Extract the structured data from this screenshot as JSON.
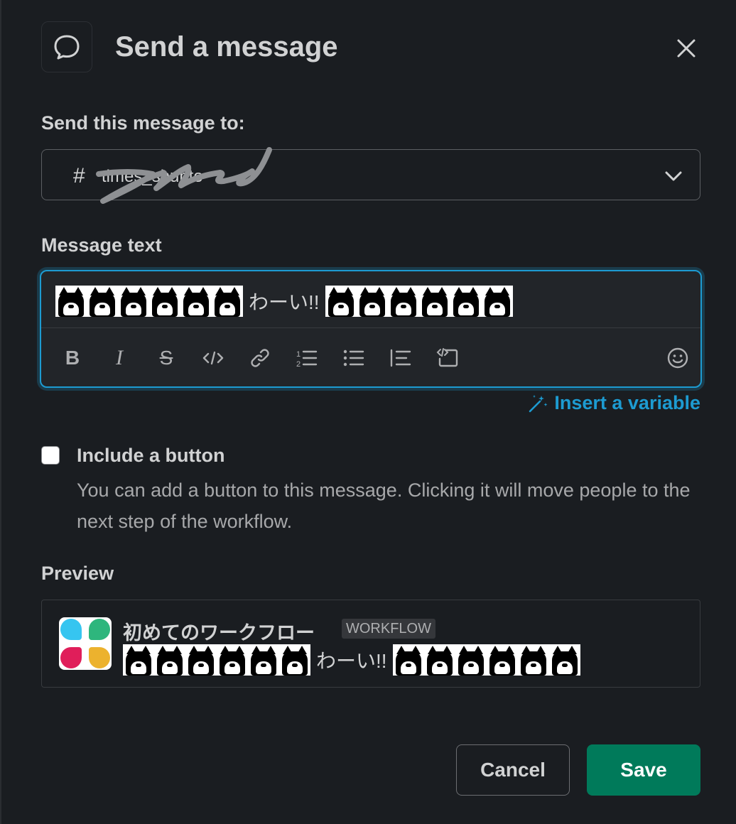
{
  "dialog": {
    "title": "Send a message",
    "close_label": "close",
    "icon": "message-bubble-icon"
  },
  "recipient": {
    "label": "Send this message to:",
    "hash": "#",
    "channel_name": "times_shunto"
  },
  "message": {
    "label": "Message text",
    "emoji_name": "cat-face-emoji",
    "emoji_count_left": 6,
    "emoji_count_right": 6,
    "text": "わーい!!"
  },
  "toolbar": {
    "buttons": [
      "bold",
      "italic",
      "strikethrough",
      "code",
      "link",
      "ordered-list",
      "bulleted-list",
      "blockquote",
      "code-block",
      "emoji"
    ]
  },
  "insert_variable": {
    "label": "Insert a variable"
  },
  "include_button": {
    "label": "Include a button",
    "description": "You can add a button to this message. Clicking it will move people to the next step of the workflow.",
    "checked": false
  },
  "preview": {
    "label": "Preview",
    "app_name": "初めてのワークフロー",
    "badge": "WORKFLOW",
    "text": "わーい!!"
  },
  "footer": {
    "cancel_label": "Cancel",
    "save_label": "Save"
  },
  "colors": {
    "background": "#1a1d21",
    "accent": "#1d9bd1",
    "save": "#007a5a"
  }
}
